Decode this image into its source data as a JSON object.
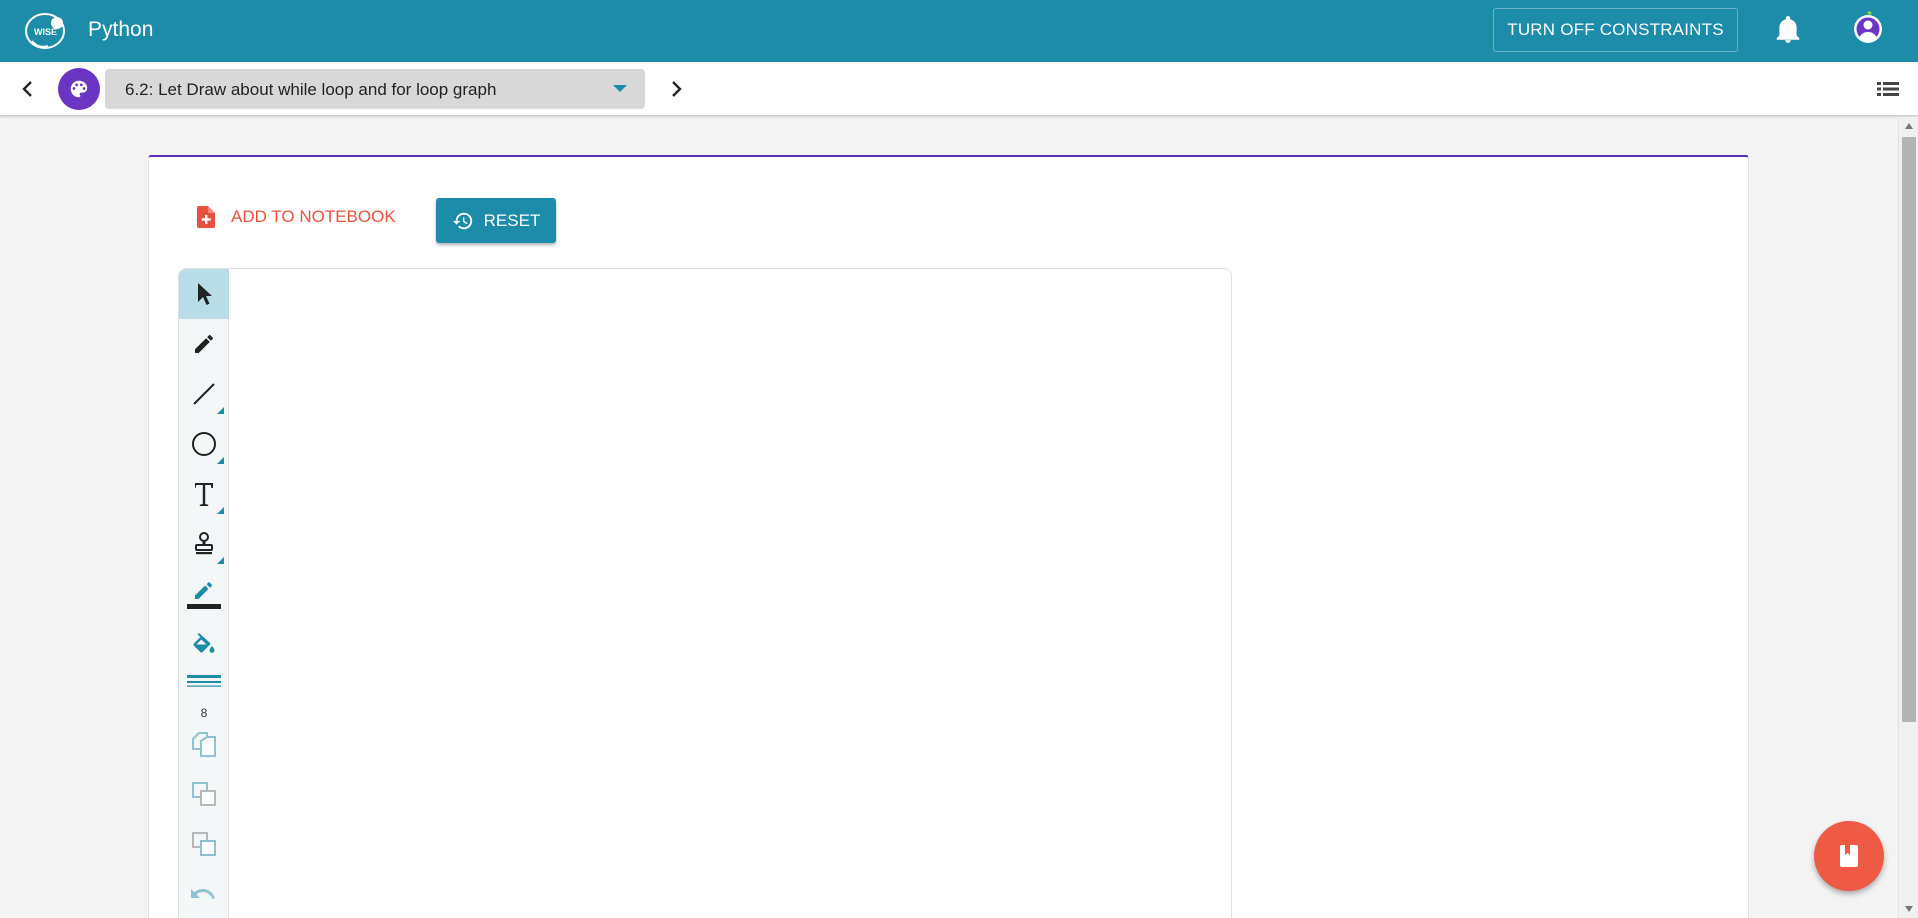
{
  "app": {
    "title": "Python",
    "logo_icon": "wise-logo-icon",
    "constraints_button": "TURN OFF CONSTRAINTS",
    "notifications_icon": "bell-icon",
    "account_icon": "account-circle-icon",
    "brand_color": "#1c8ca8"
  },
  "step_nav": {
    "prev_icon": "chevron-left-icon",
    "next_icon": "chevron-right-icon",
    "step_icon": "palette-icon",
    "step_icon_color": "#6a35c2",
    "selected_step": "6.2: Let Draw about while loop and for loop graph",
    "toc_icon": "list-icon"
  },
  "component": {
    "add_to_notebook_label": "ADD TO NOTEBOOK",
    "add_to_notebook_icon": "note-add-icon",
    "reset_label": "RESET",
    "reset_icon": "history-icon"
  },
  "draw_tools": [
    {
      "name": "select",
      "icon": "cursor-arrow-icon",
      "active": true,
      "enabled": true
    },
    {
      "name": "pencil",
      "icon": "pencil-icon",
      "active": false,
      "enabled": true
    },
    {
      "name": "line",
      "icon": "line-icon",
      "active": false,
      "enabled": true,
      "has_submenu": true
    },
    {
      "name": "circle",
      "icon": "circle-icon",
      "active": false,
      "enabled": true,
      "has_submenu": true
    },
    {
      "name": "text",
      "icon": "text-icon",
      "active": false,
      "enabled": true,
      "has_submenu": true
    },
    {
      "name": "stamp",
      "icon": "stamp-icon",
      "active": false,
      "enabled": true,
      "has_submenu": true
    },
    {
      "name": "stroke-color",
      "icon": "stroke-color-icon",
      "active": false,
      "enabled": true
    },
    {
      "name": "fill-color",
      "icon": "paint-bucket-icon",
      "active": false,
      "enabled": true
    },
    {
      "name": "stroke-width",
      "icon": "stroke-width-icon",
      "value": "8",
      "active": false,
      "enabled": true
    },
    {
      "name": "clone",
      "icon": "clone-icon",
      "active": false,
      "enabled": false
    },
    {
      "name": "send-back",
      "icon": "send-to-back-icon",
      "active": false,
      "enabled": false
    },
    {
      "name": "bring-front",
      "icon": "bring-to-front-icon",
      "active": false,
      "enabled": false
    },
    {
      "name": "undo",
      "icon": "undo-icon",
      "active": false,
      "enabled": false
    }
  ],
  "fab": {
    "icon": "notebook-icon",
    "color": "#ef5a45"
  }
}
